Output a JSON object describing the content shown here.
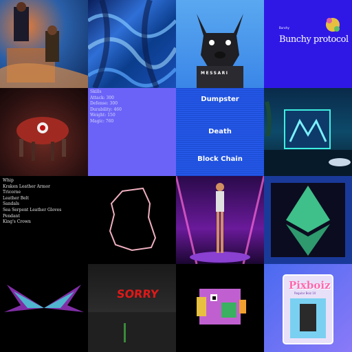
{
  "tiles": {
    "dog": {
      "brand": "MESSARI"
    },
    "bunchy": {
      "small": "Bunchy",
      "title": "Bunchy protocol"
    },
    "skills": {
      "lines": [
        "Skills",
        "Attack: 300",
        "Defense: 300",
        "Durability: 460",
        "Weight: 150",
        "Magic: 760"
      ]
    },
    "dumpster": {
      "line1": "Dumpster",
      "line2": "Death",
      "line3": "Block Chain"
    },
    "items": {
      "lines": [
        "Whip",
        "Kraken Leather Armor",
        "Tricorne",
        "Leather Belt",
        "Sandals",
        "Sea Serpent Leather Gloves",
        "Pendant",
        "King's Crown"
      ]
    },
    "sorry": {
      "text": "SORRY"
    },
    "pixboiz": {
      "title": "Pixboiz",
      "sub": "Regular Boiz 10"
    }
  },
  "colors": {
    "skills_bg": "#6b63f7",
    "dumpster_bg": "#1d4fd8",
    "bunchy_bg": "#2f18e6",
    "eth_green": "#3fbf8a",
    "sorry_red": "#e01818"
  }
}
